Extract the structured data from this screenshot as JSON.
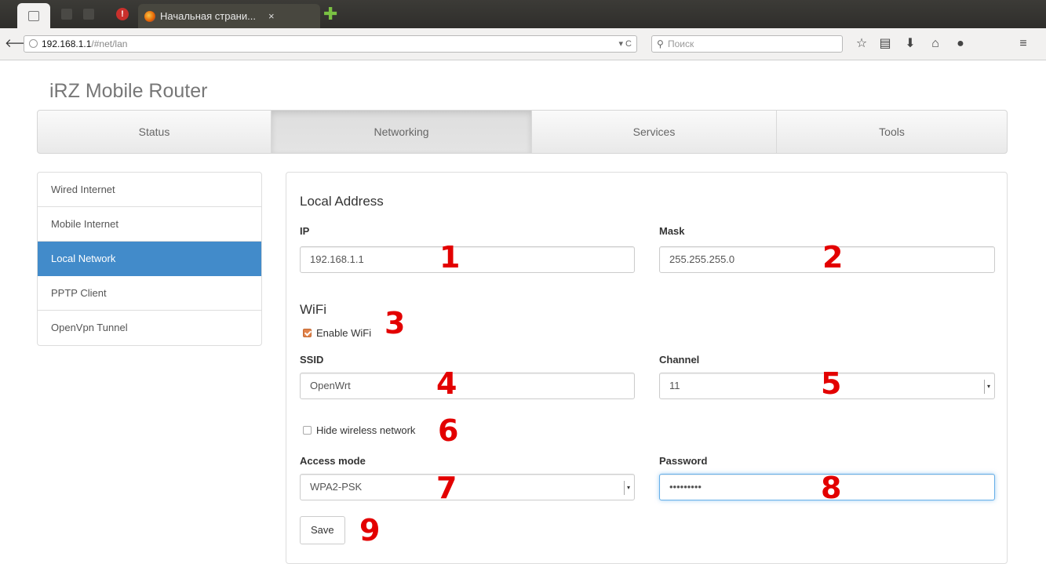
{
  "browser": {
    "tab_title": "Начальная страни...",
    "tab_close": "×",
    "url_host": "192.168.1.1",
    "url_path": "/#net/lan",
    "url_tools": "▾ C",
    "search_placeholder": "Поиск"
  },
  "brand": "iRZ Mobile Router",
  "main_nav": [
    {
      "label": "Status",
      "active": false
    },
    {
      "label": "Networking",
      "active": true
    },
    {
      "label": "Services",
      "active": false
    },
    {
      "label": "Tools",
      "active": false
    }
  ],
  "sidebar": {
    "items": [
      {
        "label": "Wired Internet",
        "active": false
      },
      {
        "label": "Mobile Internet",
        "active": false
      },
      {
        "label": "Local Network",
        "active": true
      },
      {
        "label": "PPTP Client",
        "active": false
      },
      {
        "label": "OpenVpn Tunnel",
        "active": false
      }
    ]
  },
  "form": {
    "local_address_title": "Local Address",
    "ip_label": "IP",
    "ip_value": "192.168.1.1",
    "mask_label": "Mask",
    "mask_value": "255.255.255.0",
    "wifi_title": "WiFi",
    "enable_wifi_label": "Enable WiFi",
    "enable_wifi_checked": true,
    "ssid_label": "SSID",
    "ssid_value": "OpenWrt",
    "channel_label": "Channel",
    "channel_value": "11",
    "hide_network_label": "Hide wireless network",
    "hide_network_checked": false,
    "access_mode_label": "Access mode",
    "access_mode_value": "WPA2-PSK",
    "password_label": "Password",
    "password_value": "•••••••••",
    "save_label": "Save"
  },
  "markers": [
    "1",
    "2",
    "3",
    "4",
    "5",
    "6",
    "7",
    "8",
    "9"
  ],
  "colors": {
    "active_blue": "#428bca",
    "marker_red": "#e30000",
    "checkbox_orange": "#e2834a"
  }
}
